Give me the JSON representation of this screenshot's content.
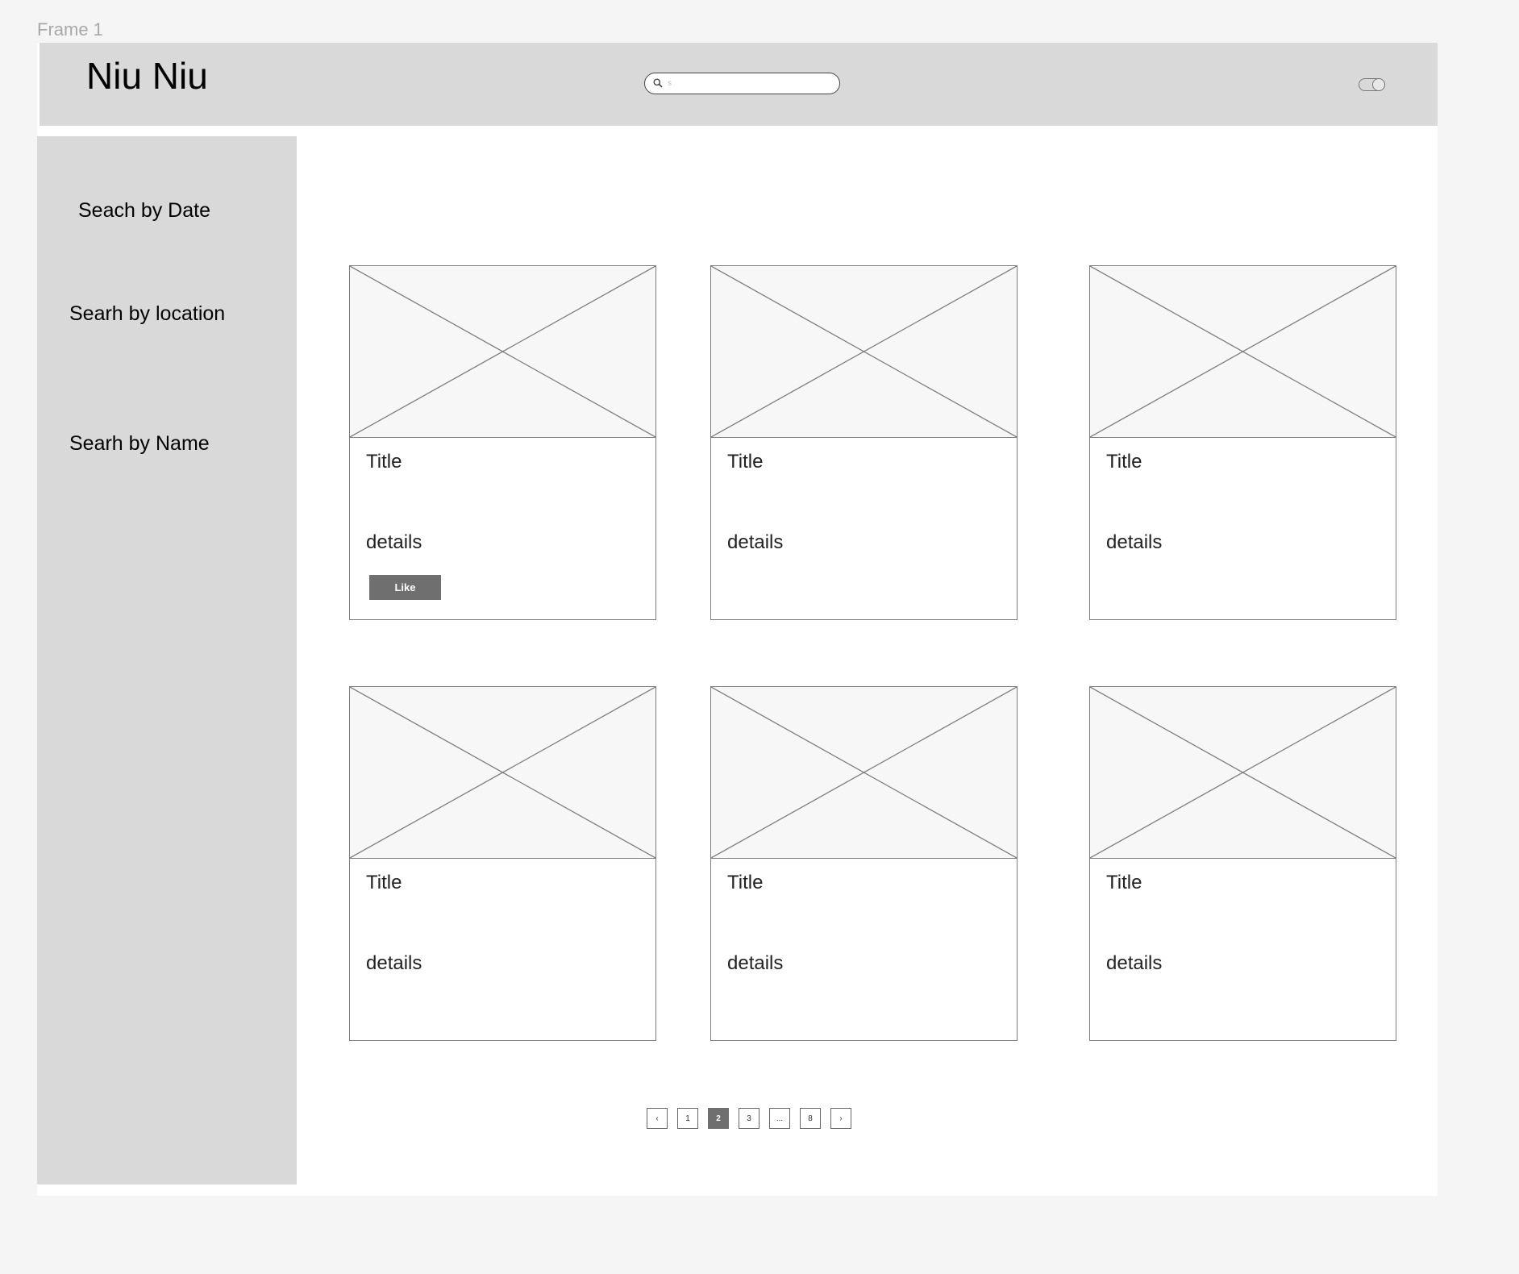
{
  "frame": {
    "label": "Frame 1"
  },
  "header": {
    "brand": "Niu Niu",
    "search": {
      "placeholder": "s"
    }
  },
  "sidebar": {
    "items": [
      {
        "label": "Seach by Date"
      },
      {
        "label": "Searh by location"
      },
      {
        "label": "Searh by Name"
      }
    ]
  },
  "cards": [
    {
      "title": "Title",
      "details": "details",
      "button": "Like"
    },
    {
      "title": "Title",
      "details": "details"
    },
    {
      "title": "Title",
      "details": "details"
    },
    {
      "title": "Title",
      "details": "details"
    },
    {
      "title": "Title",
      "details": "details"
    },
    {
      "title": "Title",
      "details": "details"
    }
  ],
  "pagination": {
    "prev": "‹",
    "pages": [
      "1",
      "2",
      "3",
      "...",
      "8"
    ],
    "current": "2",
    "next": "›"
  },
  "icons": {
    "search": "search-icon",
    "toggle": "toggle-switch-icon",
    "image_placeholder": "image-placeholder-icon"
  }
}
